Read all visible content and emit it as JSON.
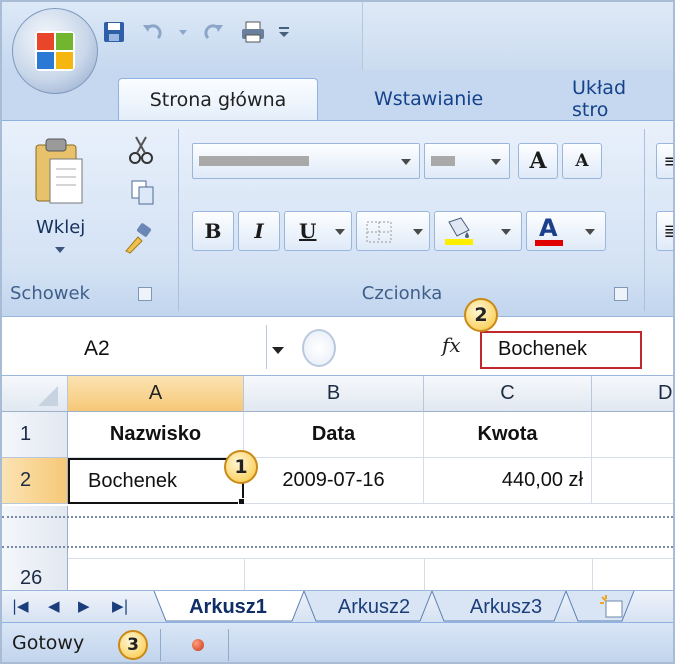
{
  "ribbon_tabs": [
    "Strona główna",
    "Wstawianie",
    "Układ stro"
  ],
  "clipboard": {
    "paste_label": "Wklej",
    "group_label": "Schowek"
  },
  "font": {
    "group_label": "Czcionka",
    "bold": "B",
    "italic": "I",
    "underline": "U",
    "grow": "A",
    "shrink": "A",
    "color_letter": "A"
  },
  "formula_bar": {
    "name_box": "A2",
    "fx": "fx",
    "content": "Bochenek"
  },
  "columns": [
    "A",
    "B",
    "C",
    "D"
  ],
  "rows": [
    {
      "num": "1",
      "cells": [
        "Nazwisko",
        "Data",
        "Kwota"
      ]
    },
    {
      "num": "2",
      "cells": [
        "Bochenek",
        "2009-07-16",
        "440,00 zł"
      ]
    }
  ],
  "last_row": "26",
  "sheets": [
    "Arkusz1",
    "Arkusz2",
    "Arkusz3"
  ],
  "status": "Gotowy",
  "badges": [
    "1",
    "2",
    "3"
  ],
  "colors": {
    "accent_red": "#c0282e",
    "highlight_yellow": "#ffee00",
    "font_red": "#e00000",
    "selected_header": "#f6c877"
  }
}
